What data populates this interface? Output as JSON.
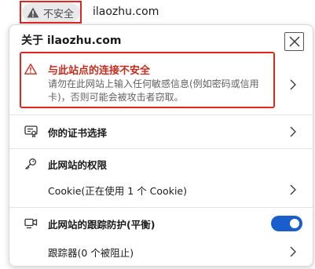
{
  "address_bar": {
    "security_label": "不安全",
    "url": "ilaozhu.com"
  },
  "popup": {
    "title": "关于 ilaozhu.com",
    "warning": {
      "title": "与此站点的连接不安全",
      "description": "请勿在此网站上输入任何敏感信息(例如密码或信用卡)，否则可能会被攻击者窃取。"
    },
    "certificate_label": "你的证书选择",
    "permissions_label": "此网站的权限",
    "cookie_label": "Cookie(正在使用 1 个 Cookie)",
    "tracking_label": "此网站的跟踪防护(平衡)",
    "tracking_enabled": true,
    "trackers_label": "跟踪器(0 个被阻止)"
  },
  "colors": {
    "warning_red": "#c42b1c",
    "highlight_red": "#e0271f",
    "toggle_blue": "#1a5ecd"
  }
}
